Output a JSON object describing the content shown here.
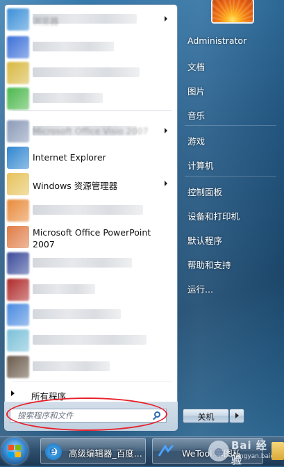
{
  "start_menu": {
    "programs": [
      {
        "label": "浏览器",
        "obscured": true,
        "has_arrow": true,
        "icon": "browser-icon",
        "color": "#3a8fd8"
      },
      {
        "label": "",
        "obscured": true,
        "icon": "blurred-app-icon",
        "color": "#3b6fd8"
      },
      {
        "label": "",
        "obscured": true,
        "icon": "blurred-app-icon",
        "color": "#d8b840"
      },
      {
        "label": "",
        "obscured": true,
        "icon": "blurred-app-icon",
        "color": "#4bb84b"
      },
      {
        "label": "Microsoft Office Visio 2007",
        "obscured": true,
        "has_arrow": true,
        "icon": "visio-icon",
        "color": "#8a9ab8"
      },
      {
        "label": "Internet Explorer",
        "obscured": false,
        "icon": "internet-explorer-icon",
        "color": "#2f86d0"
      },
      {
        "label": "Windows 资源管理器",
        "obscured": false,
        "has_arrow": true,
        "icon": "folder-icon",
        "color": "#e6c25a"
      },
      {
        "label": "",
        "obscured": true,
        "icon": "blurred-app-icon",
        "color": "#e88a3a"
      },
      {
        "label": "Microsoft Office PowerPoint",
        "label2": "2007",
        "obscured": false,
        "icon": "powerpoint-icon",
        "color": "#e07b45"
      },
      {
        "label": "",
        "obscured": true,
        "icon": "blurred-app-icon",
        "color": "#3a4a9a"
      },
      {
        "label": "",
        "obscured": true,
        "icon": "blurred-app-icon",
        "color": "#b02a2a"
      },
      {
        "label": "",
        "obscured": true,
        "icon": "blurred-app-icon",
        "color": "#4a8ae0"
      },
      {
        "label": "",
        "obscured": true,
        "icon": "blurred-app-icon",
        "color": "#7ac0d8"
      },
      {
        "label": "",
        "obscured": true,
        "icon": "blurred-app-icon",
        "color": "#6a5a4a"
      }
    ],
    "all_programs": "所有程序",
    "search_placeholder": "搜索程序和文件"
  },
  "right_panel": {
    "user": "Administrator",
    "items": [
      "文档",
      "图片",
      "音乐",
      "游戏",
      "计算机",
      "控制面板",
      "设备和打印机",
      "默认程序",
      "帮助和支持",
      "运行..."
    ]
  },
  "shutdown": {
    "label": "关机"
  },
  "taskbar": {
    "tasks": [
      {
        "label": "高级编辑器_百度...",
        "icon": "internet-explorer-icon"
      },
      {
        "label": "WeTool 车图私",
        "icon": "wetool-icon"
      }
    ]
  },
  "watermark": {
    "line1": "Bai 经验",
    "line2": "jingyan.baidu.com"
  },
  "colors": {
    "highlight": "#e8202a",
    "taskbar": "#2f4f6e",
    "menu_bg": "#ffffff"
  }
}
